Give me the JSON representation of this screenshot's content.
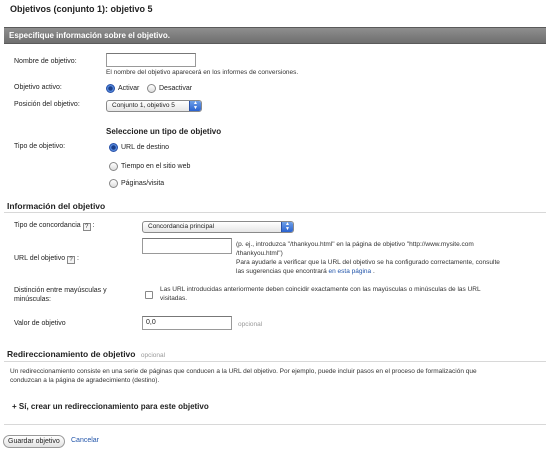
{
  "page_title": "Objetivos (conjunto 1): objetivo 5",
  "section_header": "Especifique información sobre el objetivo.",
  "goal_name": {
    "label": "Nombre de objetivo:",
    "value": "",
    "hint": "El nombre del objetivo aparecerá en los informes de conversiones."
  },
  "goal_active": {
    "label": "Objetivo activo:",
    "options": [
      "Activar",
      "Desactivar"
    ],
    "selected": "Activar"
  },
  "goal_position": {
    "label": "Posición del objetivo:",
    "value": "Conjunto 1, objetivo 5"
  },
  "goal_type": {
    "heading": "Seleccione un tipo de objetivo",
    "label": "Tipo de objetivo:",
    "options": [
      "URL de destino",
      "Tiempo en el sitio web",
      "Páginas/visita"
    ],
    "selected": "URL de destino"
  },
  "goal_info": {
    "heading": "Información del objetivo",
    "match_type": {
      "label": "Tipo de concordancia",
      "help": "?",
      "value": "Concordancia principal"
    },
    "goal_url": {
      "label": "URL del objetivo",
      "help": "?",
      "value": "",
      "hint_line1": "(p. ej., introduzca \"/thankyou.html\" en la página de objetivo \"http://www.mysite.com",
      "hint_line2": "/thankyou.html\")",
      "hint_line3": "Para ayudarle a verificar que la URL del objetivo se ha configurado correctamente, consulte",
      "hint_line4": "las sugerencias que encontrará",
      "hint_link": "en esta página",
      "hint_end": "."
    },
    "case_sensitive": {
      "label_line1": "Distinción entre mayúsculas y",
      "label_line2": "minúsculas:",
      "checked": false,
      "hint_line1": "Las URL introducidas anteriormente deben coincidir exactamente con las mayúsculas o minúsculas de las URL",
      "hint_line2": "visitadas."
    },
    "goal_value": {
      "label": "Valor de objetivo",
      "value": "0,0",
      "optional": "opcional"
    }
  },
  "funnel": {
    "heading": "Redireccionamiento de objetivo",
    "optional": "opcional",
    "description_line1": "Un redireccionamiento consiste en una serie de páginas que conducen a la URL del objetivo. Por ejemplo, puede incluir pasos en el proceso de formalización que",
    "description_line2": "conduzcan a la página de agradecimiento (destino).",
    "create_link": "+ Sí, crear un redireccionamiento para este objetivo"
  },
  "actions": {
    "save": "Guardar objetivo",
    "cancel": "Cancelar"
  },
  "colors": {
    "header_bar": "#7f7f7f",
    "link": "#2255aa",
    "muted": "#999999"
  }
}
